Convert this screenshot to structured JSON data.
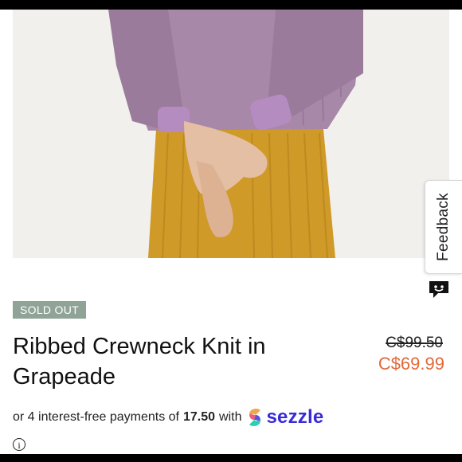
{
  "product": {
    "badge": "SOLD OUT",
    "title": "Ribbed Crewneck Knit in Grapeade",
    "original_price": "C$99.50",
    "sale_price": "C$69.99"
  },
  "payment": {
    "prefix": "or 4 interest-free payments of",
    "amount": "17.50",
    "suffix": "with",
    "brand": "sezzle"
  },
  "feedback": {
    "label": "Feedback"
  },
  "colors": {
    "badge_bg": "#8fa396",
    "sale_price": "#e0693a",
    "sezzle_brand": "#382ad8"
  },
  "icons": [
    "photo-product-image",
    "feedback-chat-icon",
    "sezzle-logo-icon",
    "info-icon"
  ]
}
